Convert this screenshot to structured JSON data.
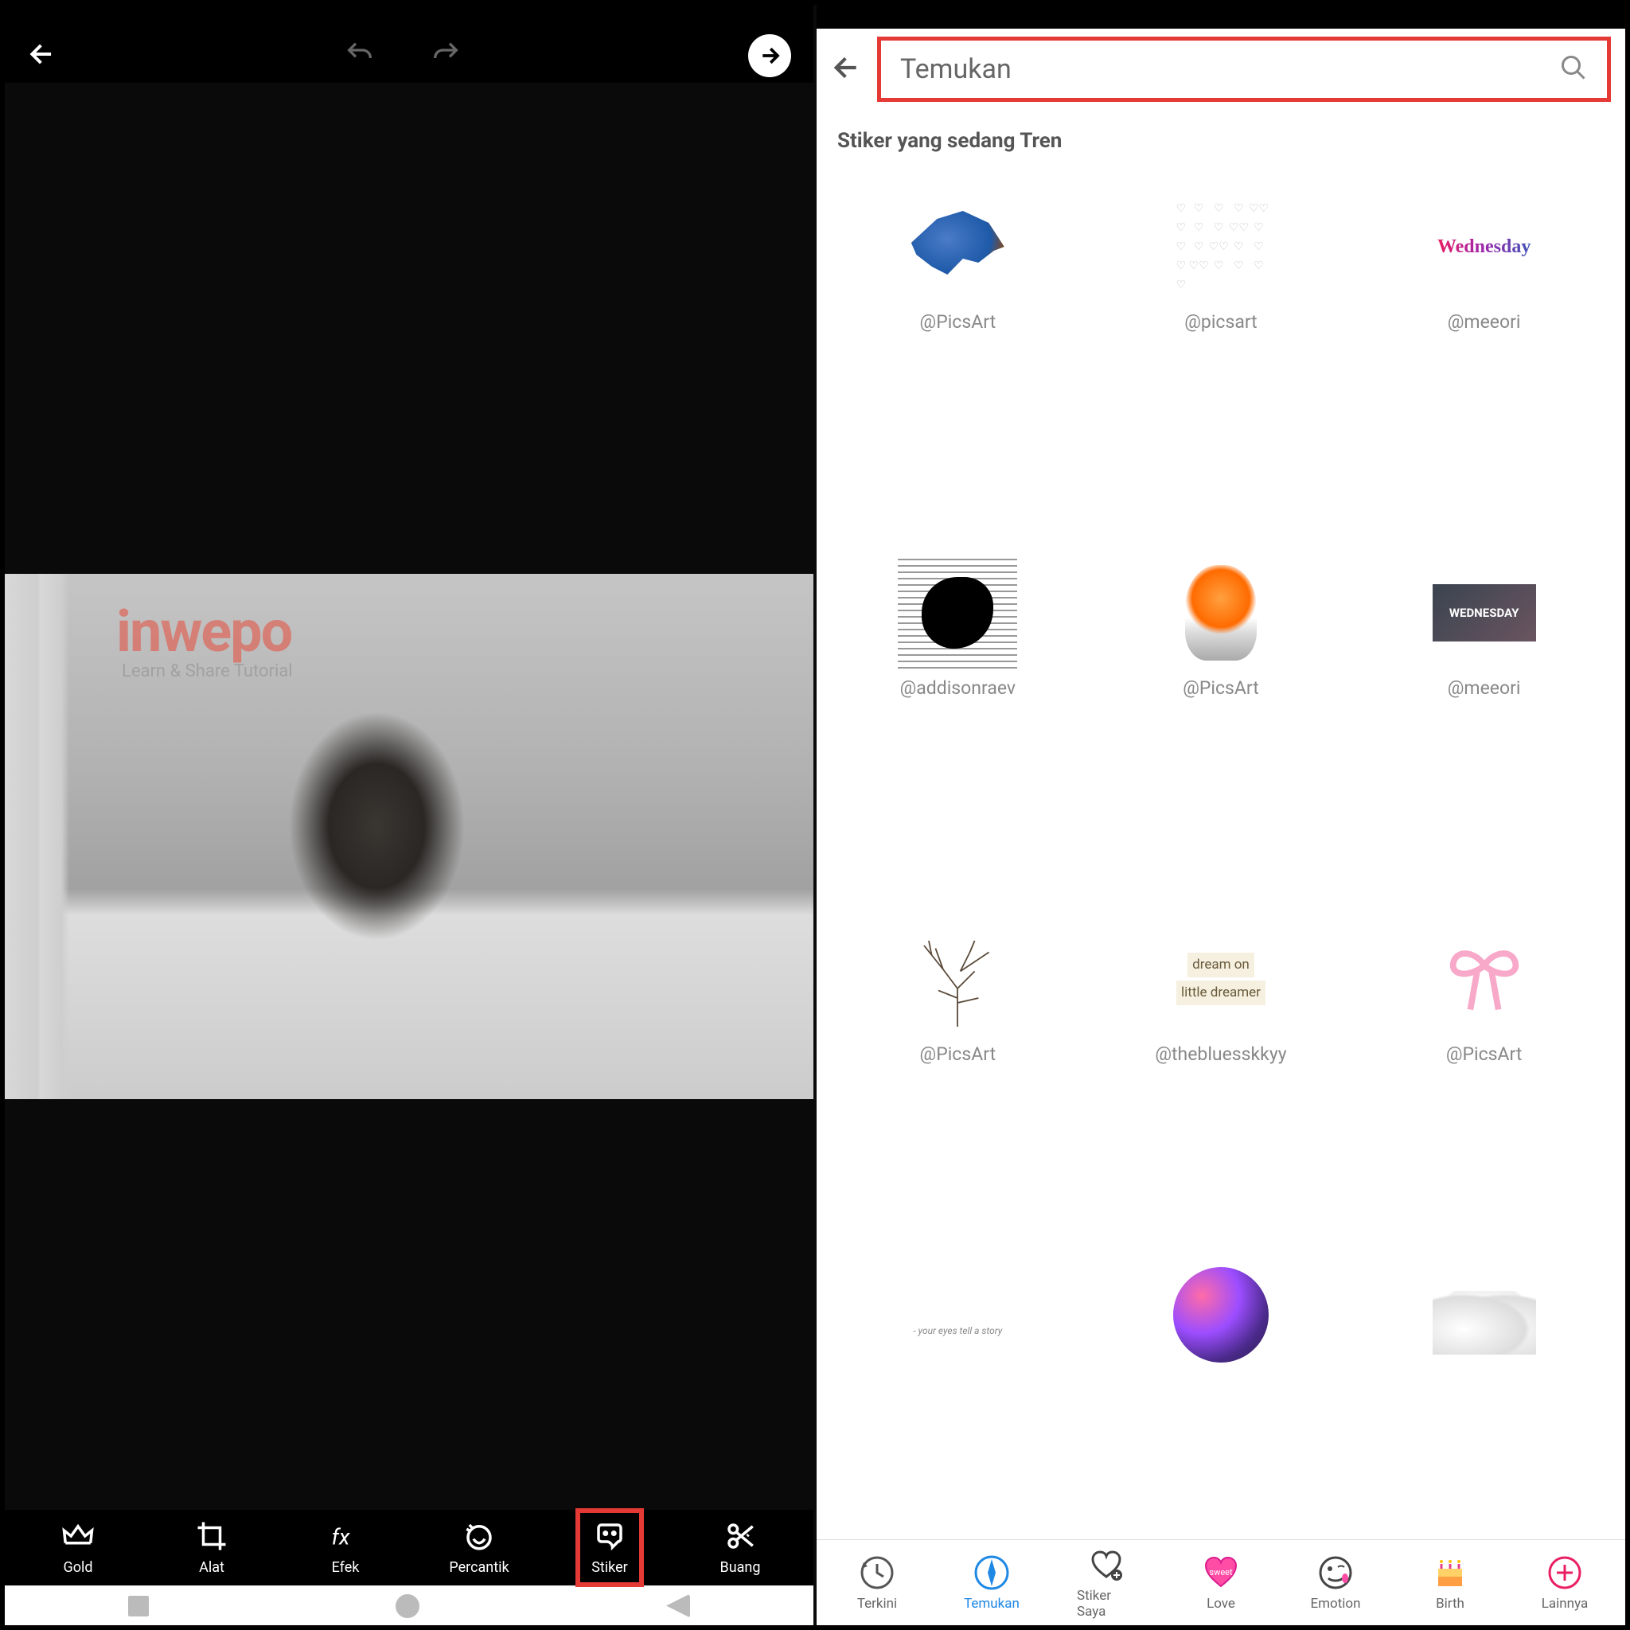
{
  "left_panel": {
    "watermark": "inwepo",
    "watermark_sub": "Learn & Share Tutorial",
    "tools": [
      {
        "id": "gold",
        "label": "Gold"
      },
      {
        "id": "alat",
        "label": "Alat"
      },
      {
        "id": "efek",
        "label": "Efek"
      },
      {
        "id": "percantik",
        "label": "Percantik"
      },
      {
        "id": "stiker",
        "label": "Stiker",
        "highlighted": true
      },
      {
        "id": "buang",
        "label": "Buang"
      }
    ]
  },
  "right_panel": {
    "search_placeholder": "Temukan",
    "section_title": "Stiker yang sedang Tren",
    "stickers": [
      {
        "author": "@PicsArt",
        "visual": "bird"
      },
      {
        "author": "@picsart",
        "visual": "hearts"
      },
      {
        "author": "@meeori",
        "visual": "wednesday-script",
        "text": "Wednesday"
      },
      {
        "author": "@addisonraev",
        "visual": "ink"
      },
      {
        "author": "@PicsArt",
        "visual": "bulb"
      },
      {
        "author": "@meeori",
        "visual": "wed-card",
        "text": "WEDNESDAY"
      },
      {
        "author": "@PicsArt",
        "visual": "tree"
      },
      {
        "author": "@thebluesskkyy",
        "visual": "dream",
        "line1": "dream on",
        "line2": "little dreamer"
      },
      {
        "author": "@PicsArt",
        "visual": "bow"
      },
      {
        "author": "",
        "visual": "quote",
        "text": "- your eyes tell a story"
      },
      {
        "author": "",
        "visual": "galaxy"
      },
      {
        "author": "",
        "visual": "cloud"
      }
    ],
    "tabs": [
      {
        "id": "terkini",
        "label": "Terkini"
      },
      {
        "id": "temukan",
        "label": "Temukan",
        "active": true
      },
      {
        "id": "stiker-saya",
        "label": "Stiker Saya"
      },
      {
        "id": "love",
        "label": "Love"
      },
      {
        "id": "emotion",
        "label": "Emotion"
      },
      {
        "id": "birth",
        "label": "Birth"
      },
      {
        "id": "lainnya",
        "label": "Lainnya"
      }
    ]
  }
}
